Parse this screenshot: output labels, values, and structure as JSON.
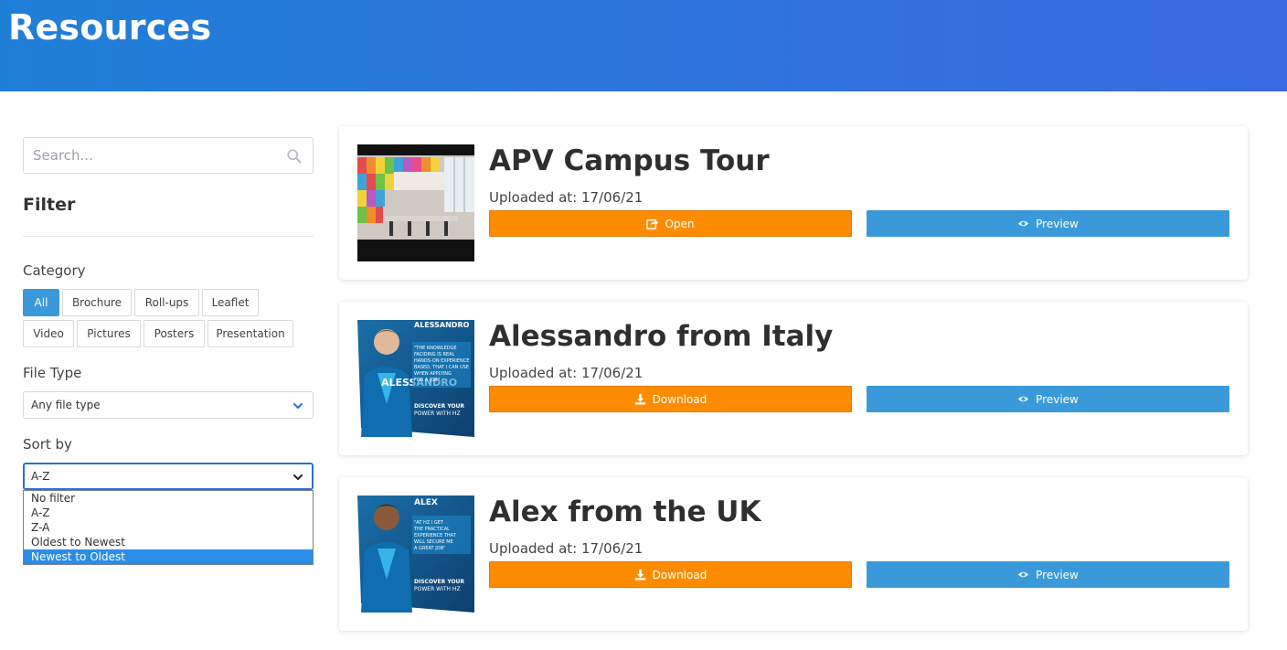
{
  "header": {
    "title": "Resources"
  },
  "sidebar": {
    "search_placeholder": "Search...",
    "filter_title": "Filter",
    "category_label": "Category",
    "categories": [
      {
        "label": "All",
        "active": true
      },
      {
        "label": "Brochure",
        "active": false
      },
      {
        "label": "Roll-ups",
        "active": false
      },
      {
        "label": "Leaflet",
        "active": false
      },
      {
        "label": "Video",
        "active": false
      },
      {
        "label": "Pictures",
        "active": false
      },
      {
        "label": "Posters",
        "active": false
      },
      {
        "label": "Presentation",
        "active": false
      }
    ],
    "file_type_label": "File Type",
    "file_type_value": "Any file type",
    "sort_label": "Sort by",
    "sort_value": "A-Z",
    "sort_options": [
      "No filter",
      "A-Z",
      "Z-A",
      "Oldest to Newest",
      "Newest to Oldest"
    ],
    "sort_highlighted": "Newest to Oldest"
  },
  "resources": [
    {
      "title": "APV Campus Tour",
      "uploaded": "Uploaded at: 17/06/21",
      "primary_label": "Open",
      "primary_icon": "external-link-icon",
      "preview_label": "Preview"
    },
    {
      "title": "Alessandro from Italy",
      "uploaded": "Uploaded at: 17/06/21",
      "primary_label": "Download",
      "primary_icon": "download-icon",
      "preview_label": "Preview"
    },
    {
      "title": "Alex from the UK",
      "uploaded": "Uploaded at: 17/06/21",
      "primary_label": "Download",
      "primary_icon": "download-icon",
      "preview_label": "Preview"
    }
  ],
  "colors": {
    "header_start": "#1f7fd6",
    "header_end": "#3a6ae0",
    "primary_button": "#ff8c00",
    "preview_button": "#3a9ad9",
    "active_chip": "#3a9ad9"
  },
  "poster_text": {
    "alessandro": [
      "ALESSANDRO",
      "\"THE KNOWLEDGE",
      "FACIDING IS REAL",
      "HANDS-ON EXPERIENCE",
      "BASED, THAT I CAN USE",
      "WHEN APPLYING",
      "FOR A JOB\"",
      "DISCOVER YOUR",
      "POWER WITH HZ"
    ],
    "alex": [
      "ALEX",
      "\"AT HZ I GET",
      "THE PRACTICAL",
      "EXPERIENCE THAT",
      "WILL SECURE ME",
      "A GREAT JOB\"",
      "DISCOVER YOUR",
      "POWER WITH HZ"
    ]
  }
}
